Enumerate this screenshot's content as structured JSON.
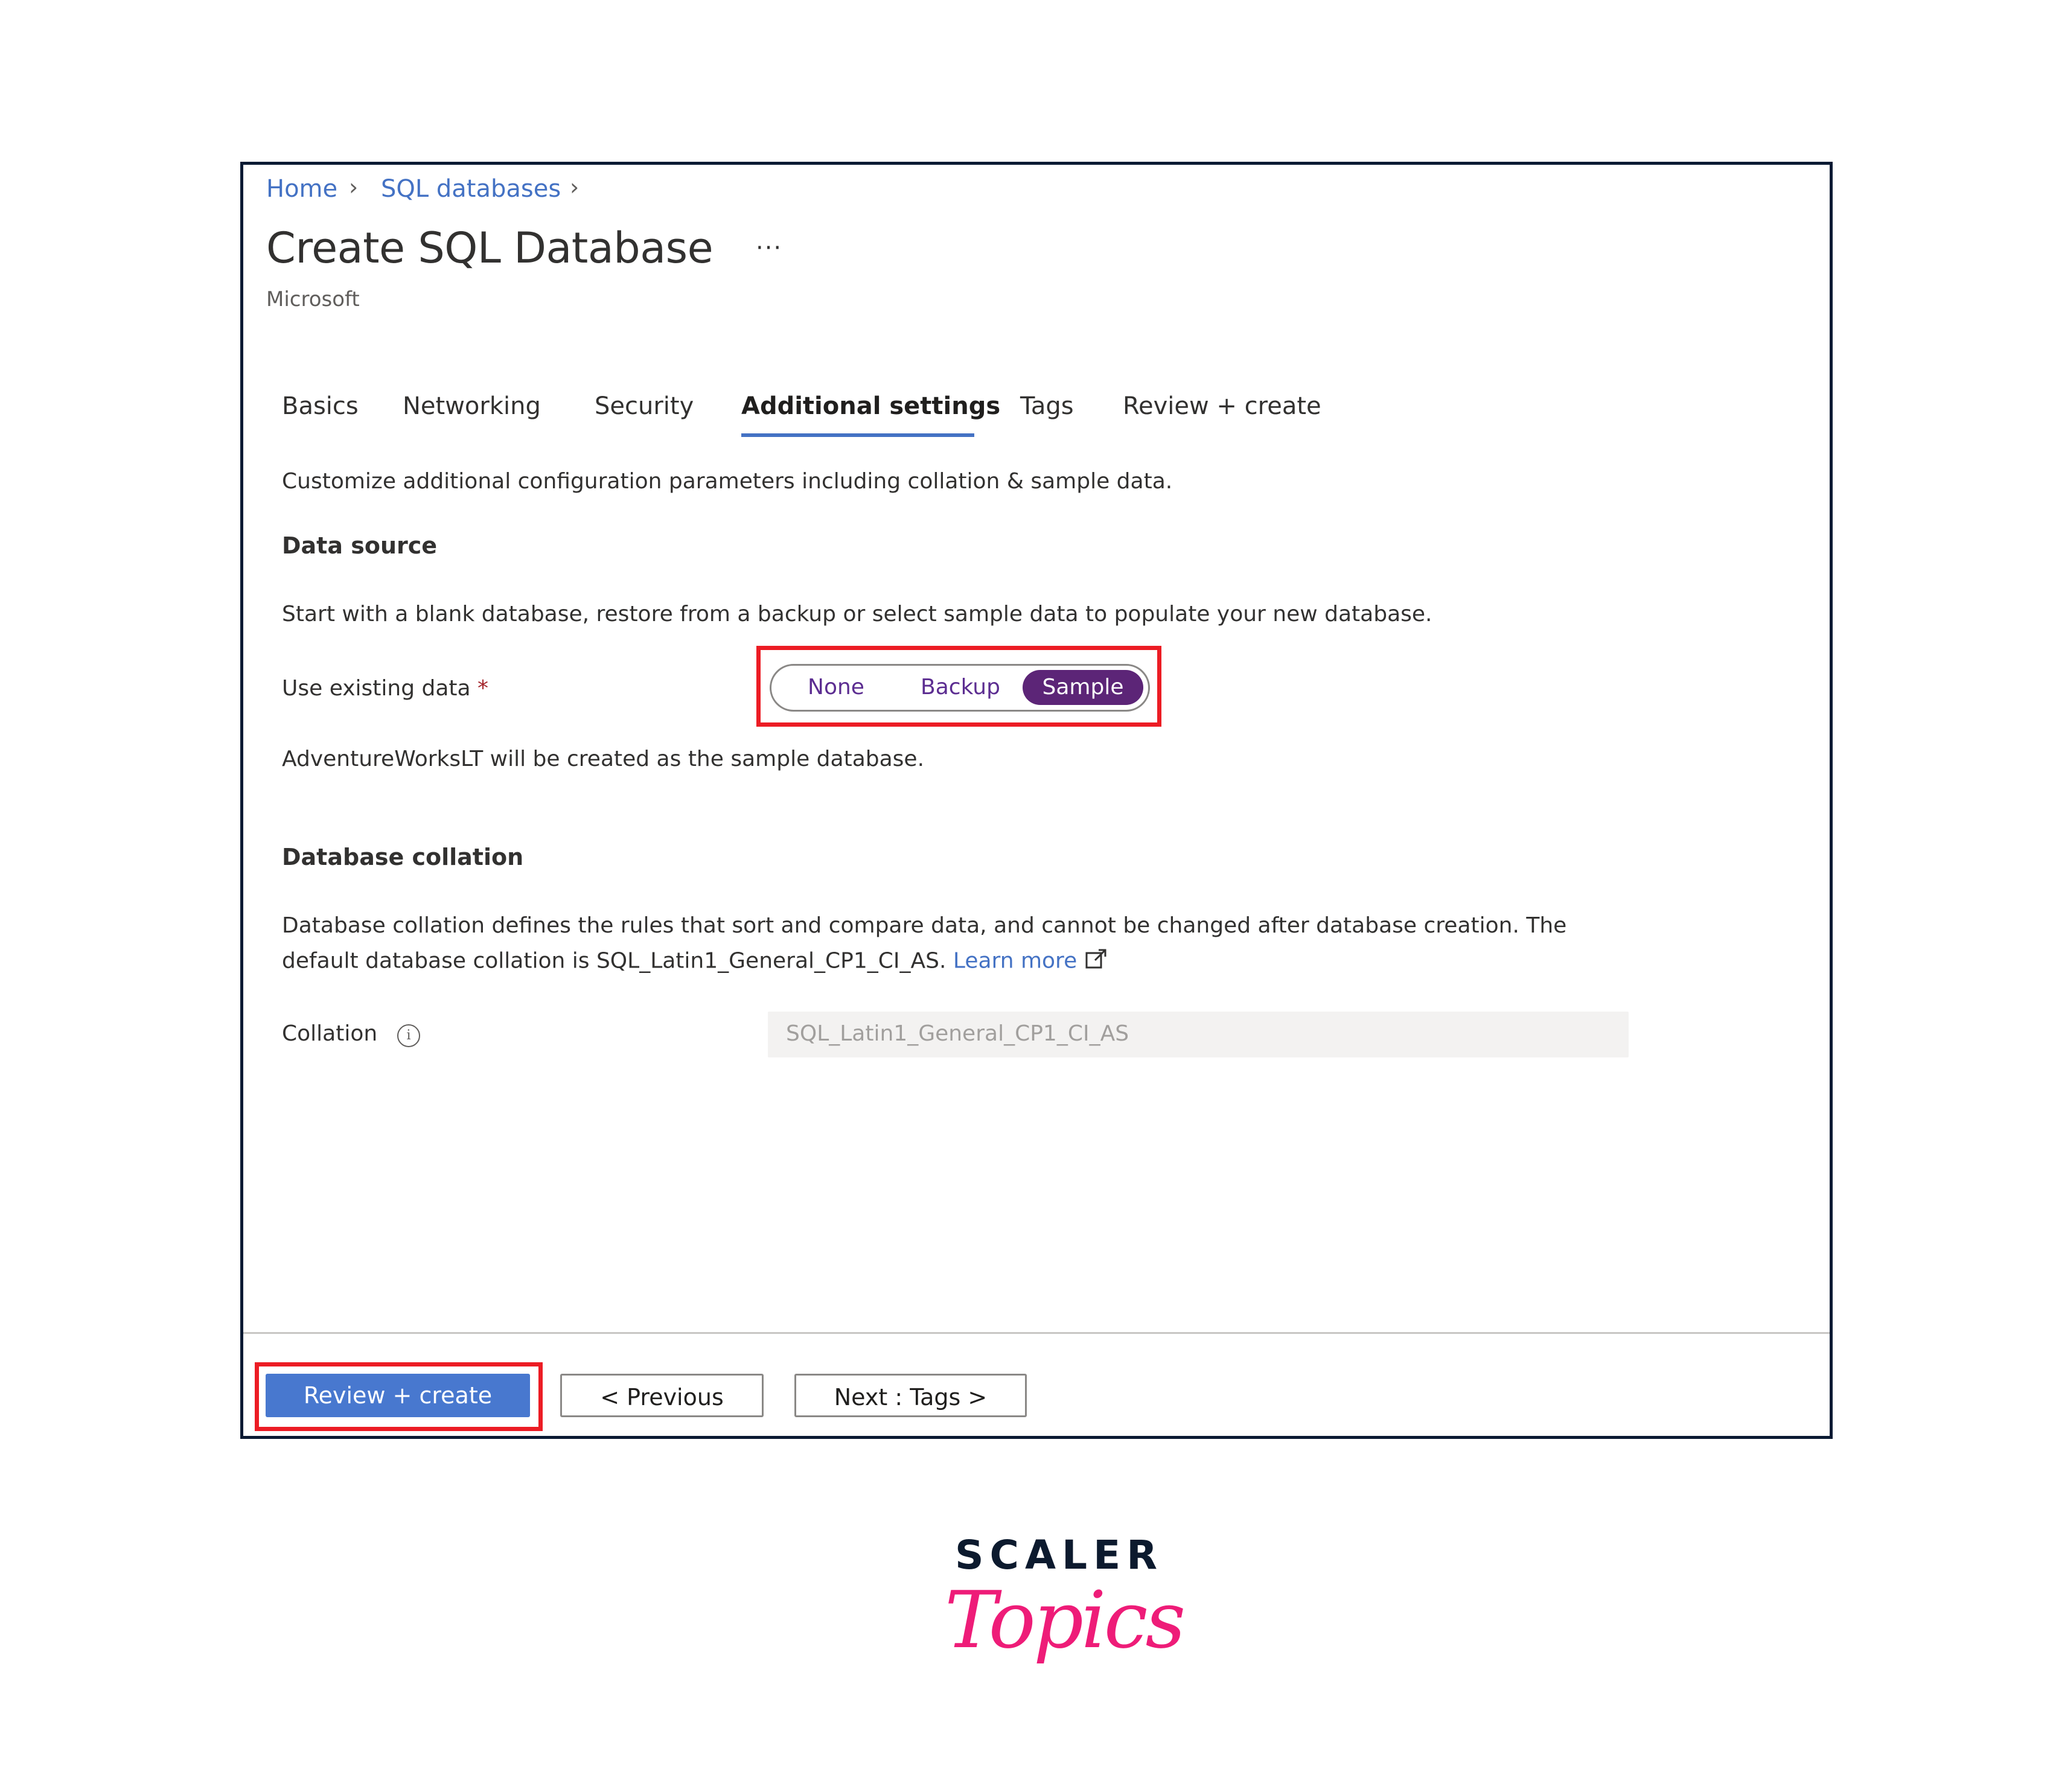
{
  "breadcrumb": [
    {
      "label": "Home"
    },
    {
      "label": "SQL databases"
    }
  ],
  "breadcrumb_separator": "›",
  "header": {
    "title": "Create SQL Database",
    "more_label": "···",
    "publisher": "Microsoft"
  },
  "tabs": [
    {
      "label": "Basics",
      "active": false
    },
    {
      "label": "Networking",
      "active": false
    },
    {
      "label": "Security",
      "active": false
    },
    {
      "label": "Additional settings",
      "active": true
    },
    {
      "label": "Tags",
      "active": false
    },
    {
      "label": "Review + create",
      "active": false
    }
  ],
  "intro": "Customize additional configuration parameters including collation & sample data.",
  "data_source": {
    "heading": "Data source",
    "description": "Start with a blank database, restore from a backup or select sample data to populate your new database.",
    "field_label": "Use existing data",
    "required_mark": "*",
    "options": [
      "None",
      "Backup",
      "Sample"
    ],
    "selected": "Sample",
    "note": "AdventureWorksLT will be created as the sample database."
  },
  "collation": {
    "heading": "Database collation",
    "description_line1": "Database collation defines the rules that sort and compare data, and cannot be changed after database creation. The",
    "description_line2": "default database collation is SQL_Latin1_General_CP1_CI_AS.",
    "learn_more": "Learn more",
    "field_label": "Collation",
    "info_icon": "i",
    "value": "SQL_Latin1_General_CP1_CI_AS"
  },
  "footer": {
    "review_create": "Review + create",
    "previous": "< Previous",
    "next": "Next : Tags >"
  },
  "branding": {
    "line1": "SCALER",
    "line2": "Topics"
  },
  "colors": {
    "accent": "#4472c4",
    "selected_option": "#5c2577",
    "highlight_box": "#ec1c24",
    "logo_pink": "#ee1c78"
  }
}
